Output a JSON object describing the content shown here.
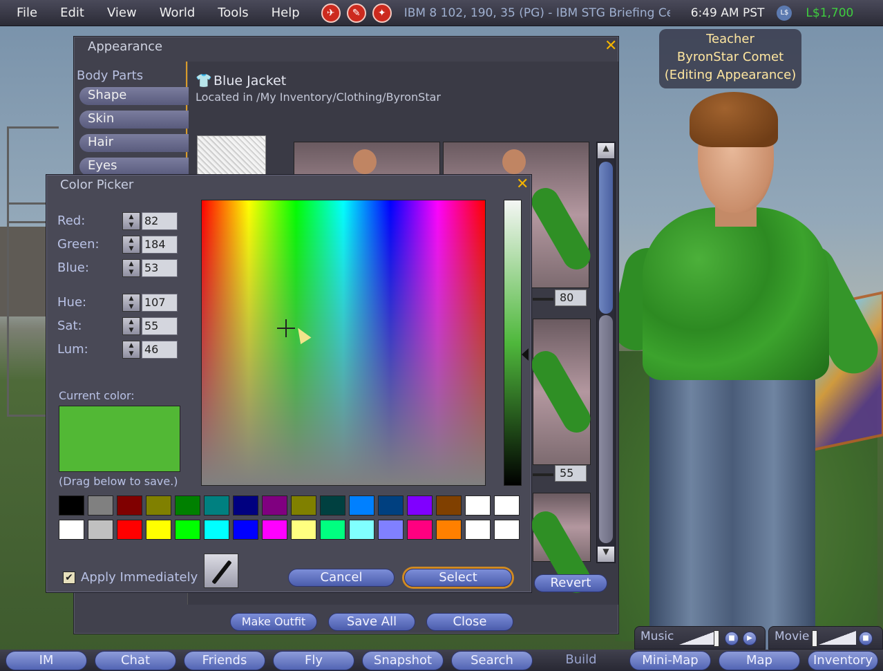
{
  "menubar": {
    "menus": [
      "File",
      "Edit",
      "View",
      "World",
      "Tools",
      "Help"
    ],
    "region": "IBM 8 102, 190, 35 (PG) - IBM STG Briefing Ce",
    "clock": "6:49 AM PST",
    "currency_icon": "L$",
    "balance": "L$1,700",
    "flag_icons": [
      "no-fly-icon",
      "no-build-icon",
      "no-script-icon"
    ]
  },
  "nametag": {
    "line1": "Teacher",
    "line2": "ByronStar Comet",
    "line3": "(Editing Appearance)"
  },
  "appearance": {
    "title": "Appearance",
    "body_parts_header": "Body Parts",
    "body_parts": [
      "Shape",
      "Skin",
      "Hair",
      "Eyes"
    ],
    "item_name": "Blue Jacket",
    "item_location": "Located in /My Inventory/Clothing/ByronStar",
    "slider_values": [
      "80",
      "55"
    ],
    "buttons": {
      "revert": "Revert",
      "make_outfit": "Make Outfit",
      "save_all": "Save All",
      "close": "Close"
    }
  },
  "color_picker": {
    "title": "Color Picker",
    "fields": [
      {
        "label": "Red:",
        "value": "82"
      },
      {
        "label": "Green:",
        "value": "184"
      },
      {
        "label": "Blue:",
        "value": "53"
      },
      {
        "label": "Hue:",
        "value": "107"
      },
      {
        "label": "Sat:",
        "value": "55"
      },
      {
        "label": "Lum:",
        "value": "46"
      }
    ],
    "current_color_label": "Current color:",
    "current_color": "#52b835",
    "drag_hint": "(Drag below to save.)",
    "palette_row1": [
      "#000000",
      "#808080",
      "#800000",
      "#808000",
      "#008000",
      "#008080",
      "#000080",
      "#800080",
      "#808000",
      "#004040",
      "#0080ff",
      "#004080",
      "#8000ff",
      "#804000",
      "#ffffff",
      "#ffffff"
    ],
    "palette_row2": [
      "#ffffff",
      "#c0c0c0",
      "#ff0000",
      "#ffff00",
      "#00ff00",
      "#00ffff",
      "#0000ff",
      "#ff00ff",
      "#ffff80",
      "#00ff80",
      "#80ffff",
      "#8080ff",
      "#ff0080",
      "#ff8000",
      "#ffffff",
      "#ffffff"
    ],
    "apply_immediately_label": "Apply Immediately",
    "apply_immediately_checked": true,
    "cancel_label": "Cancel",
    "select_label": "Select"
  },
  "media": {
    "music_label": "Music",
    "movie_label": "Movie"
  },
  "toolbar": {
    "buttons": [
      "IM",
      "Chat",
      "Friends",
      "Fly",
      "Snapshot",
      "Search",
      "Build",
      "Mini-Map",
      "Map",
      "Inventory"
    ]
  }
}
